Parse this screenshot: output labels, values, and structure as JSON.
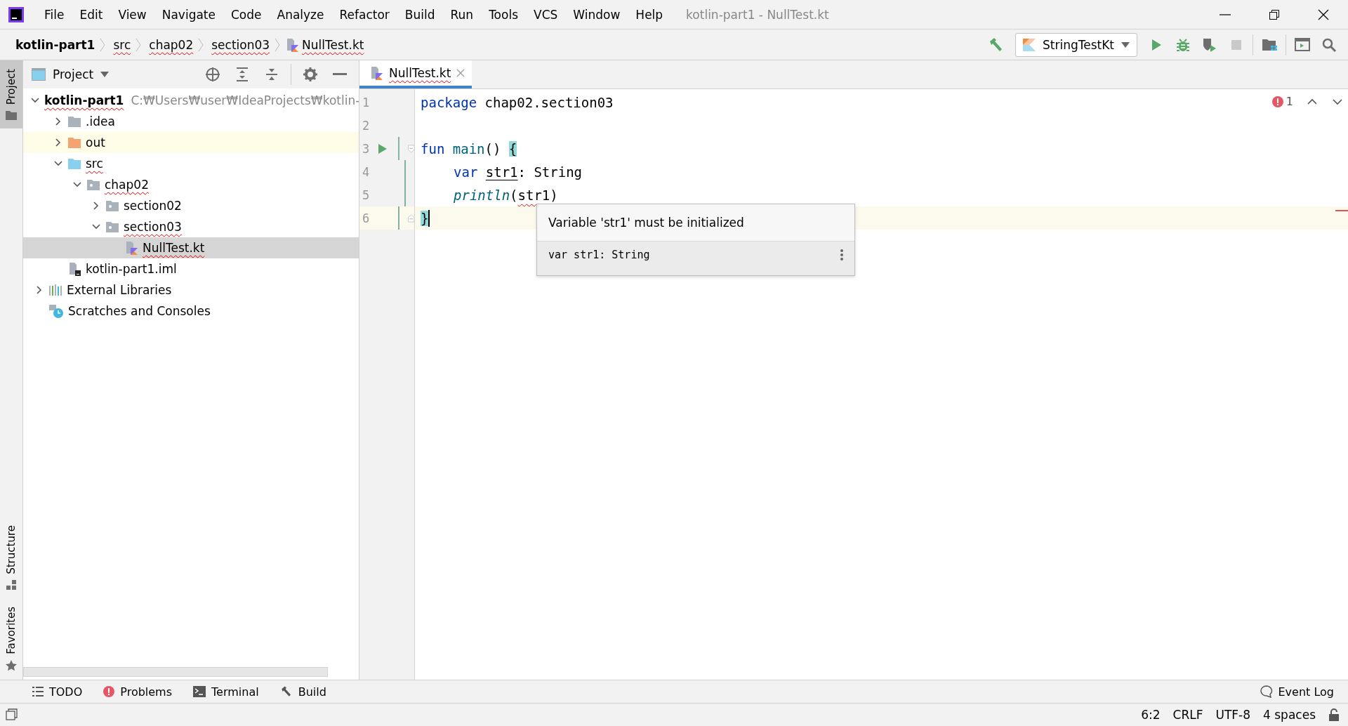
{
  "window": {
    "title": "kotlin-part1 - NullTest.kt"
  },
  "menu": [
    "File",
    "Edit",
    "View",
    "Navigate",
    "Code",
    "Analyze",
    "Refactor",
    "Build",
    "Run",
    "Tools",
    "VCS",
    "Window",
    "Help"
  ],
  "breadcrumbs": [
    {
      "label": "kotlin-part1",
      "kind": "project",
      "misspelled": false
    },
    {
      "label": "src",
      "kind": "folder",
      "misspelled": true
    },
    {
      "label": "chap02",
      "kind": "folder",
      "misspelled": true
    },
    {
      "label": "section03",
      "kind": "folder",
      "misspelled": true
    },
    {
      "label": "NullTest.kt",
      "kind": "kotlin-file",
      "misspelled": true
    }
  ],
  "run_config": {
    "label": "StringTestKt"
  },
  "toolbar": [
    {
      "kind": "build",
      "disabled": false
    },
    {
      "kind": "config"
    },
    {
      "kind": "run",
      "disabled": false
    },
    {
      "kind": "debug",
      "disabled": false
    },
    {
      "kind": "coverage",
      "disabled": false
    },
    {
      "kind": "stop",
      "disabled": true
    },
    {
      "kind": "structure",
      "disabled": false
    },
    {
      "kind": "console",
      "disabled": false
    },
    {
      "kind": "search",
      "disabled": false
    }
  ],
  "side_tabs": [
    {
      "label": "Project",
      "kind": "project",
      "selected": true
    },
    {
      "label": "Structure",
      "kind": "structure",
      "selected": false
    },
    {
      "label": "Favorites",
      "kind": "favorites",
      "selected": false
    }
  ],
  "project_panel": {
    "title": "Project",
    "tree": [
      {
        "label": "kotlin-part1",
        "kind": "module",
        "hint": "C:₩Users₩user₩IdeaProjects₩kotlin-",
        "expanded": true,
        "selected": false,
        "misspelled": true,
        "excluded": false,
        "children": [
          {
            "label": ".idea",
            "kind": "folder",
            "expanded": false,
            "selected": false,
            "misspelled": false,
            "excluded": false
          },
          {
            "label": "out",
            "kind": "excluded-folder",
            "expanded": false,
            "selected": false,
            "misspelled": false,
            "excluded": true
          },
          {
            "label": "src",
            "kind": "source-folder",
            "expanded": true,
            "selected": false,
            "misspelled": true,
            "excluded": false,
            "children": [
              {
                "label": "chap02",
                "kind": "package",
                "expanded": true,
                "selected": false,
                "misspelled": true,
                "excluded": false,
                "children": [
                  {
                    "label": "section02",
                    "kind": "package",
                    "expanded": false,
                    "selected": false,
                    "misspelled": false,
                    "excluded": false
                  },
                  {
                    "label": "section03",
                    "kind": "package",
                    "expanded": true,
                    "selected": false,
                    "misspelled": true,
                    "excluded": false,
                    "children": [
                      {
                        "label": "NullTest.kt",
                        "kind": "kotlin-file",
                        "selected": true,
                        "misspelled": true,
                        "excluded": false
                      }
                    ]
                  }
                ]
              }
            ]
          },
          {
            "label": "kotlin-part1.iml",
            "kind": "iml-file",
            "selected": false,
            "misspelled": false,
            "excluded": false
          }
        ]
      },
      {
        "label": "External Libraries",
        "kind": "libraries",
        "expanded": false,
        "selected": false,
        "misspelled": false,
        "excluded": false
      },
      {
        "label": "Scratches and Consoles",
        "kind": "scratches",
        "selected": false,
        "misspelled": false,
        "excluded": false
      }
    ]
  },
  "editor": {
    "tabs": [
      {
        "label": "NullTest.kt",
        "selected": true,
        "misspelled": true
      }
    ],
    "lines": [
      {
        "number": "1",
        "current": false,
        "run_marker": false,
        "fold_start": false,
        "fold_end": false,
        "caret": false,
        "indented": false,
        "tokens": [
          {
            "text": "package ",
            "kind": "keyword"
          },
          {
            "text": "chap02.section03",
            "kind": "plain"
          }
        ]
      },
      {
        "number": "2",
        "current": false,
        "run_marker": false,
        "fold_start": false,
        "fold_end": false,
        "caret": false
      },
      {
        "number": "3",
        "current": false,
        "run_marker": true,
        "fold_start": true,
        "fold_end": false,
        "caret": false,
        "indented": false,
        "tokens": [
          {
            "text": "fun ",
            "kind": "keyword"
          },
          {
            "text": "main",
            "kind": "function"
          },
          {
            "text": "() ",
            "kind": "plain"
          },
          {
            "text": "{",
            "kind": "brace"
          }
        ]
      },
      {
        "number": "4",
        "current": false,
        "run_marker": false,
        "fold_start": false,
        "fold_end": false,
        "caret": false,
        "indented": true,
        "tokens": [
          {
            "text": "var ",
            "kind": "keyword"
          },
          {
            "text": "str1",
            "kind": "underline"
          },
          {
            "text": ": String",
            "kind": "plain"
          }
        ]
      },
      {
        "number": "5",
        "current": false,
        "run_marker": false,
        "fold_start": false,
        "fold_end": false,
        "caret": false,
        "indented": true,
        "tokens": [
          {
            "text": "println",
            "kind": "call"
          },
          {
            "text": "(",
            "kind": "plain"
          },
          {
            "text": "str1",
            "kind": "error"
          },
          {
            "text": ")",
            "kind": "plain"
          }
        ]
      },
      {
        "number": "6",
        "current": true,
        "run_marker": false,
        "fold_start": false,
        "fold_end": true,
        "caret": true,
        "indented": false,
        "tokens": [
          {
            "text": "}",
            "kind": "brace"
          }
        ]
      }
    ],
    "problems": {
      "count": "1"
    },
    "popup": {
      "message": "Variable 'str1' must be initialized",
      "code": "var str1: String"
    }
  },
  "tool_windows": [
    {
      "label": "TODO",
      "kind": "todo"
    },
    {
      "label": "Problems",
      "kind": "problems"
    },
    {
      "label": "Terminal",
      "kind": "terminal"
    },
    {
      "label": "Build",
      "kind": "build"
    }
  ],
  "event_log": {
    "label": "Event Log"
  },
  "status_bar": [
    "6:2",
    "CRLF",
    "UTF-8",
    "4 spaces"
  ]
}
